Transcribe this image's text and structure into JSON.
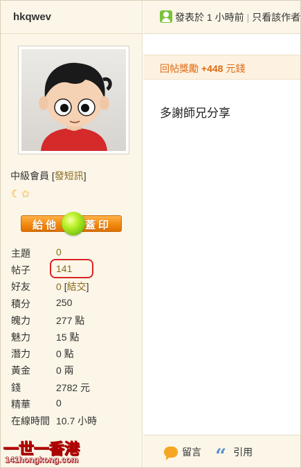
{
  "user": {
    "name": "hkqwev",
    "rank": "中級會員",
    "send_pm_bracket_open": "[",
    "send_pm_label": "發短訊",
    "send_pm_bracket_close": "]",
    "badges": "☾✩",
    "give_left": "給他",
    "give_right": "蓋印"
  },
  "stats": [
    {
      "label": "主題",
      "value": "0",
      "link": true
    },
    {
      "label": "帖子",
      "value": "141",
      "link": true,
      "highlighted": true
    },
    {
      "label": "好友",
      "value": "0",
      "link": true,
      "extra_open": "[",
      "extra": "結交",
      "extra_close": "]"
    },
    {
      "label": "積分",
      "value": "250"
    },
    {
      "label": "魄力",
      "value": "277 點"
    },
    {
      "label": "魅力",
      "value": "15 點"
    },
    {
      "label": "潛力",
      "value": "0 點"
    },
    {
      "label": "黃金",
      "value": "0 兩"
    },
    {
      "label": "錢",
      "value": "2782 元"
    },
    {
      "label": "精華",
      "value": "0"
    },
    {
      "label": "在線時間",
      "value": "10.7 小時"
    }
  ],
  "logo": {
    "line1": "一世一香港",
    "line2": "141hongkong.com"
  },
  "post": {
    "posted": "發表於 1 小時前",
    "sep": "|",
    "only_view": "只看該作者",
    "reward_label": "回帖獎勵 ",
    "reward_amount": "+448",
    "reward_unit": " 元錢",
    "body": "多謝師兄分享",
    "reply_label": "留言",
    "quote_label": "引用"
  },
  "colors": {
    "accent_link": "#8a6a1e",
    "reward": "#e06a12",
    "highlight_circle": "#d22222"
  }
}
